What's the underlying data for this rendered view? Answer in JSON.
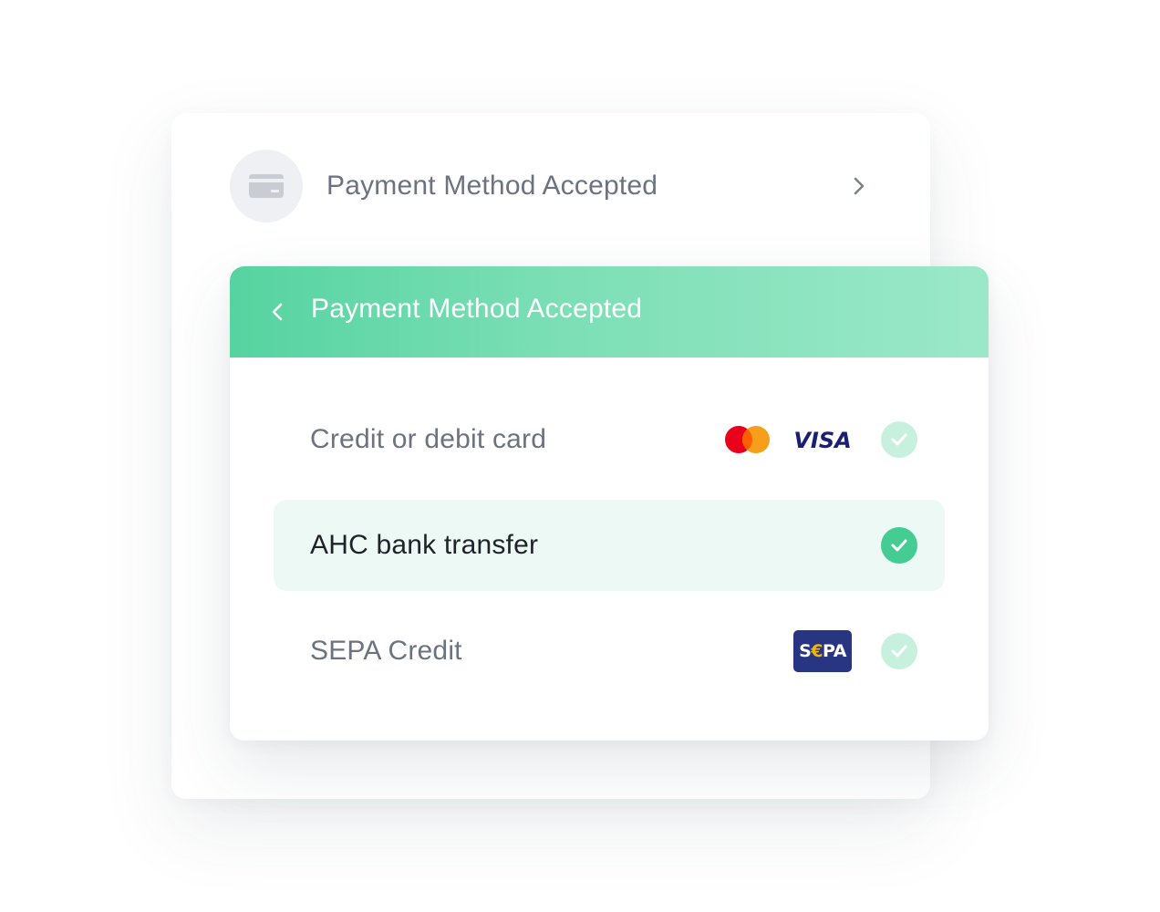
{
  "back_card": {
    "title": "Payment Method Accepted",
    "icon": "credit-card-icon",
    "chevron": "chevron-right-icon"
  },
  "front_card": {
    "header": {
      "title": "Payment Method Accepted",
      "back_icon": "chevron-left-icon",
      "gradient": [
        "#56d3a0",
        "#9be8c8"
      ]
    },
    "options": [
      {
        "label": "Credit or debit card",
        "selected": false,
        "logos": [
          "mastercard-logo",
          "visa-logo"
        ],
        "visa_text": "VISA"
      },
      {
        "label": "AHC bank transfer",
        "selected": true,
        "logos": []
      },
      {
        "label": "SEPA Credit",
        "selected": false,
        "logos": [
          "sepa-logo"
        ],
        "sepa_text_s": "S",
        "sepa_text_euro": "€",
        "sepa_text_pa": "PA"
      }
    ]
  },
  "colors": {
    "accent": "#45cc92",
    "accent_light": "#c7f0df",
    "selected_bg": "#edf9f4",
    "muted_text": "#6b7280",
    "dark_text": "#1f2329"
  }
}
